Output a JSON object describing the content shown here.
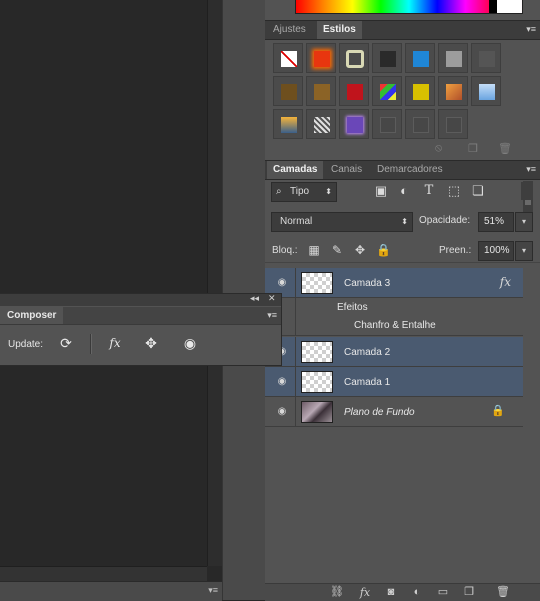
{
  "composer": {
    "tab_label": "Composer",
    "update_label": "Update:",
    "collapse_glyph": "◂◂",
    "close_glyph": "✕",
    "menu_glyph": "▾≡",
    "icons": [
      "refresh-icon",
      "fx-icon",
      "move-icon",
      "visibility-icon"
    ],
    "fx_text": "fx"
  },
  "canvas": {
    "menu_glyph": "▾≡"
  },
  "styles_panel": {
    "tabs": [
      {
        "label": "Ajustes",
        "active": false
      },
      {
        "label": "Estilos",
        "active": true
      }
    ],
    "menu_glyph": "▾≡",
    "swatches": [
      {
        "name": "no-style",
        "color": "#ffffff"
      },
      {
        "name": "red-glow",
        "color": "#e8360f"
      },
      {
        "name": "outline-frame",
        "color": "#d9d9b5"
      },
      {
        "name": "chrome-ball",
        "color": "#2a2a2a"
      },
      {
        "name": "blue-bevel",
        "color": "#1f86d6"
      },
      {
        "name": "gray-flat",
        "color": "#9c9c9c"
      },
      {
        "name": "steel-gradient",
        "color": "#555555"
      },
      {
        "name": "bronze-bevel",
        "color": "#6e4f1e"
      },
      {
        "name": "gold-bevel",
        "color": "#8b6326"
      },
      {
        "name": "red-button",
        "color": "#c0141c"
      },
      {
        "name": "colorful-pattern",
        "color": "#3b7bd8"
      },
      {
        "name": "yellow-button",
        "color": "#d7c000"
      },
      {
        "name": "orange-gradient",
        "color": "#d07a2c"
      },
      {
        "name": "sky-gradient",
        "color": "#83b4e8"
      },
      {
        "name": "sunset-photo",
        "color": "#d47d1c"
      },
      {
        "name": "cracked-texture",
        "color": "#bfbfbf"
      },
      {
        "name": "purple-glow",
        "color": "#6a47b8"
      },
      {
        "name": "empty-1",
        "color": "#474747"
      },
      {
        "name": "empty-2",
        "color": "#474747"
      },
      {
        "name": "empty-3",
        "color": "#474747"
      }
    ],
    "footer_icons": [
      "clear-style-icon",
      "new-style-icon",
      "delete-style-icon"
    ]
  },
  "layers_panel": {
    "tabs": [
      {
        "label": "Camadas",
        "active": true
      },
      {
        "label": "Canais",
        "active": false
      },
      {
        "label": "Demarcadores",
        "active": false
      }
    ],
    "menu_glyph": "▾≡",
    "filter_kind": "Tipo",
    "filter_icons": [
      "image-filter-icon",
      "adjustment-filter-icon",
      "type-filter-icon",
      "shape-filter-icon",
      "smart-object-filter-icon"
    ],
    "blend_mode": "Normal",
    "opacity_label": "Opacidade:",
    "opacity_value": "51%",
    "lock_label": "Bloq.:",
    "lock_icons": [
      "lock-transparency-icon",
      "lock-pixels-icon",
      "lock-position-icon",
      "lock-all-icon"
    ],
    "fill_label": "Preen.:",
    "fill_value": "100%",
    "layers": [
      {
        "name": "Camada 3",
        "selected": true,
        "has_fx": true,
        "fx_text": "fx"
      },
      {
        "effects_label": "Efeitos",
        "effect_name": "Chanfro & Entalhe"
      },
      {
        "name": "Camada 2",
        "selected": true
      },
      {
        "name": "Camada 1",
        "selected": true
      },
      {
        "name": "Plano de Fundo",
        "selected": false,
        "locked": true
      }
    ],
    "footer_icons": [
      "link-layers-icon",
      "fx-icon",
      "add-mask-icon",
      "adjustment-layer-icon",
      "new-group-icon",
      "new-layer-icon",
      "delete-layer-icon"
    ],
    "footer_fx": "fx"
  }
}
